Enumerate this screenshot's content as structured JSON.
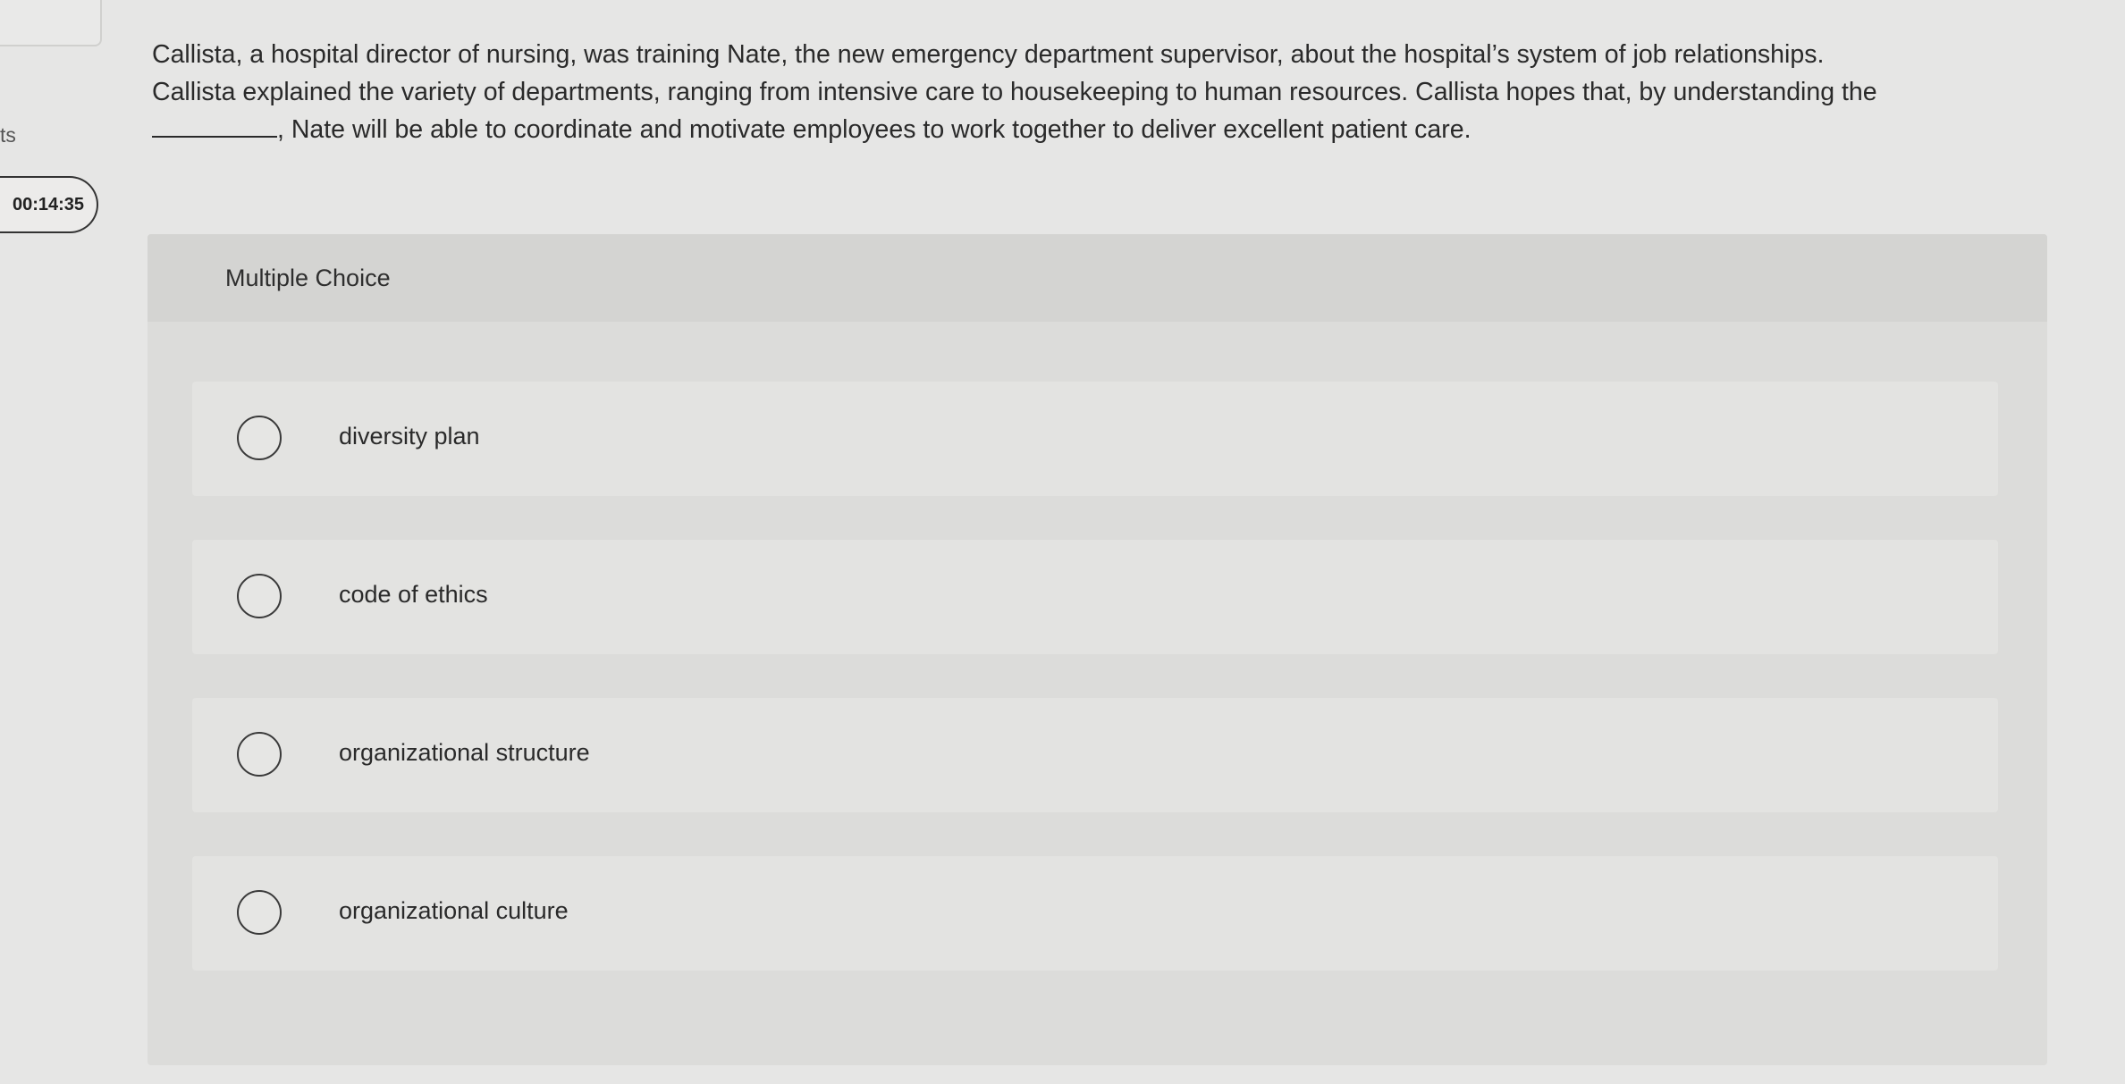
{
  "left_rail": {
    "label": "ts",
    "timer": "00:14:35"
  },
  "question": {
    "line1": "Callista, a hospital director of nursing, was training Nate, the new emergency department supervisor, about the hospital’s system of job relationships.",
    "line2": "Callista explained the variety of departments, ranging from intensive care to housekeeping to human resources. Callista hopes that, by understanding the",
    "line3_after_blank": ", Nate will be able to coordinate and motivate employees to work together to deliver excellent patient care."
  },
  "panel": {
    "header": "Multiple Choice",
    "options": [
      {
        "label": "diversity plan",
        "selected": false
      },
      {
        "label": "code of ethics",
        "selected": false
      },
      {
        "label": "organizational structure",
        "selected": false
      },
      {
        "label": "organizational culture",
        "selected": false
      }
    ]
  }
}
